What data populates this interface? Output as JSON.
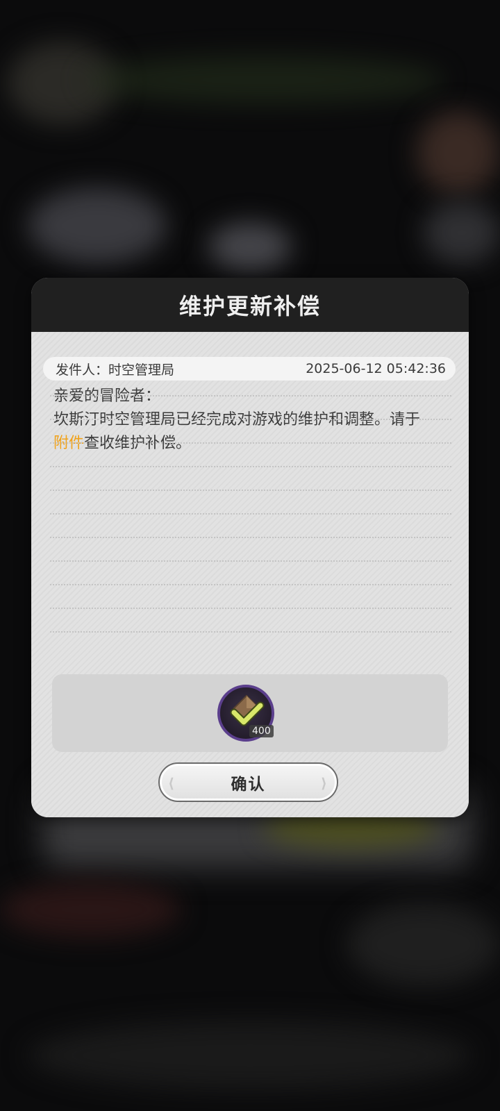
{
  "dialog": {
    "title": "维护更新补偿",
    "sender": "发件人：时空管理局",
    "timestamp": "2025-06-12 05:42:36",
    "message": {
      "greeting": "亲爱的冒险者：",
      "body_line": "坎斯汀时空管理局已经完成对游戏的维护和调整。请于",
      "attachment_link": "附件",
      "tail": "查收维护补偿。"
    },
    "attachments": [
      {
        "icon": "checkmark-gem-icon",
        "quantity": "400"
      }
    ],
    "confirm_label": "确认"
  },
  "colors": {
    "header_bg": "#202020",
    "panel_bg": "#e2e2e2",
    "highlight": "#f0a21a",
    "item_ring": "#5b3f8c"
  }
}
